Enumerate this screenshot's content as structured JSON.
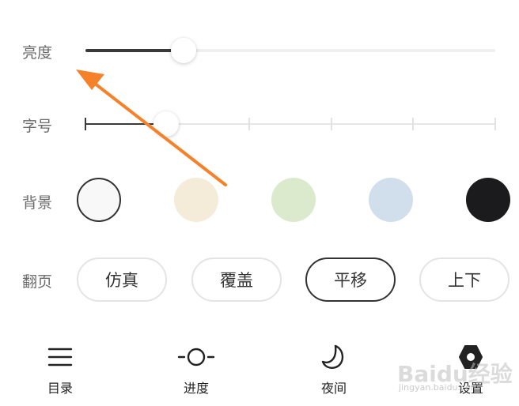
{
  "settings": {
    "brightness": {
      "label": "亮度",
      "level": 0.24
    },
    "font_size": {
      "label": "字号",
      "steps": 6,
      "selected_step": 1
    },
    "background": {
      "label": "背景",
      "options": [
        "#f8f8f8",
        "#f4ecd8",
        "#dbeacc",
        "#d1deec",
        "#1b1b1d"
      ],
      "selected": 0
    },
    "page_turn": {
      "label": "翻页",
      "options": [
        "仿真",
        "覆盖",
        "平移",
        "上下"
      ],
      "selected": "平移"
    }
  },
  "bottom_nav": {
    "items": [
      {
        "label": "目录",
        "icon": "menu-icon"
      },
      {
        "label": "进度",
        "icon": "progress-icon"
      },
      {
        "label": "夜间",
        "icon": "moon-icon"
      },
      {
        "label": "设置",
        "icon": "settings-icon"
      }
    ]
  },
  "annotation": {
    "arrow_color": "#f5822a"
  },
  "watermark": {
    "text": "Baidu经验",
    "sub": "jingyan.baidu.com"
  }
}
